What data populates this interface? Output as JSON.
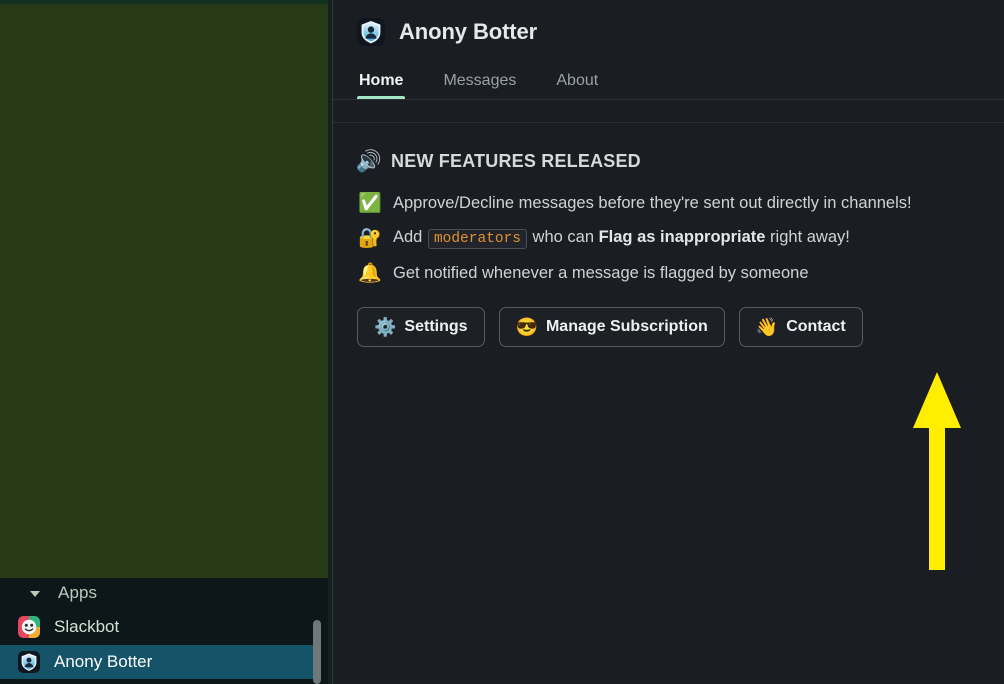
{
  "sidebar": {
    "section": {
      "label": "Apps",
      "disclosure_icon": "chevron-down-icon",
      "expanded": true
    },
    "apps": [
      {
        "name": "Slackbot",
        "icon": "slackbot-icon",
        "selected": false
      },
      {
        "name": "Anony Botter",
        "icon": "shield-person-icon",
        "selected": true
      }
    ],
    "colors": {
      "background": "#263a17",
      "lower_background": "#0d1719",
      "selected_highlight": "#155368",
      "text": "#cfe2d6",
      "scrollbar_thumb": "#6f7878"
    }
  },
  "main": {
    "header": {
      "app_name": "Anony Botter",
      "logo_icon": "shield-person-icon"
    },
    "tabs": [
      {
        "label": "Home",
        "active": true
      },
      {
        "label": "Messages",
        "active": false
      },
      {
        "label": "About",
        "active": false
      }
    ],
    "tab_underline_color": "#9fe6c5",
    "section": {
      "emoji": "🔊",
      "emoji_name": "speaker-icon",
      "title": "NEW FEATURES RELEASED"
    },
    "features": [
      {
        "emoji": "✅",
        "emoji_name": "check-mark-button-icon",
        "parts": [
          {
            "type": "text",
            "value": "Approve/Decline messages before they're sent out directly in channels!"
          }
        ]
      },
      {
        "emoji": "🔐",
        "emoji_name": "locked-with-key-icon",
        "parts": [
          {
            "type": "text",
            "value": "Add "
          },
          {
            "type": "code",
            "value": "moderators"
          },
          {
            "type": "text",
            "value": " who can "
          },
          {
            "type": "bold",
            "value": "Flag as inappropriate"
          },
          {
            "type": "text",
            "value": " right away!"
          }
        ]
      },
      {
        "emoji": "🔔",
        "emoji_name": "bell-icon",
        "parts": [
          {
            "type": "text",
            "value": "Get notified whenever a message is flagged by someone"
          }
        ]
      }
    ],
    "buttons": [
      {
        "emoji": "⚙️",
        "emoji_name": "gear-icon",
        "label": "Settings"
      },
      {
        "emoji": "😎",
        "emoji_name": "sunglasses-face-icon",
        "label": "Manage Subscription"
      },
      {
        "emoji": "👋",
        "emoji_name": "waving-hand-icon",
        "label": "Contact"
      }
    ],
    "colors": {
      "background": "#1a1d21",
      "code_text": "#e0912f",
      "body_text": "#d1d2d3"
    }
  },
  "annotation": {
    "type": "arrow",
    "direction": "up",
    "color": "#ffee00",
    "points_at": "Manage Subscription"
  }
}
